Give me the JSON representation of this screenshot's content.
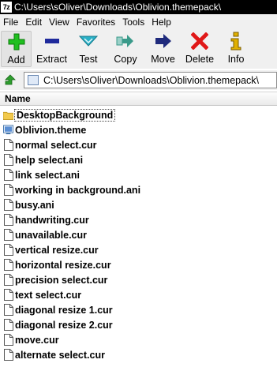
{
  "window": {
    "icon_text": "7z",
    "title": "C:\\Users\\sOliver\\Downloads\\Oblivion.themepack\\"
  },
  "menu": [
    "File",
    "Edit",
    "View",
    "Favorites",
    "Tools",
    "Help"
  ],
  "toolbar": [
    {
      "label": "Add",
      "icon": "plus-icon",
      "color": "#1fbf1f"
    },
    {
      "label": "Extract",
      "icon": "minus-icon",
      "color": "#1f2a9c"
    },
    {
      "label": "Test",
      "icon": "check-down-icon",
      "color": "#29b0c6"
    },
    {
      "label": "Copy",
      "icon": "copy-arrow-icon",
      "color": "#3a9a8a"
    },
    {
      "label": "Move",
      "icon": "move-arrow-icon",
      "color": "#1f2a7c"
    },
    {
      "label": "Delete",
      "icon": "delete-x-icon",
      "color": "#e01818"
    },
    {
      "label": "Info",
      "icon": "info-icon",
      "color": "#e0b000"
    }
  ],
  "address": {
    "path": "C:\\Users\\sOliver\\Downloads\\Oblivion.themepack\\"
  },
  "list": {
    "column_name": "Name",
    "items": [
      {
        "name": "DesktopBackground",
        "type": "folder"
      },
      {
        "name": "Oblivion.theme",
        "type": "theme"
      },
      {
        "name": "normal select.cur",
        "type": "file"
      },
      {
        "name": "help select.ani",
        "type": "file"
      },
      {
        "name": "link select.ani",
        "type": "file"
      },
      {
        "name": "working in background.ani",
        "type": "file"
      },
      {
        "name": "busy.ani",
        "type": "file"
      },
      {
        "name": "handwriting.cur",
        "type": "file"
      },
      {
        "name": "unavailable.cur",
        "type": "file"
      },
      {
        "name": "vertical resize.cur",
        "type": "file"
      },
      {
        "name": "horizontal resize.cur",
        "type": "file"
      },
      {
        "name": "precision select.cur",
        "type": "file"
      },
      {
        "name": "text select.cur",
        "type": "file"
      },
      {
        "name": "diagonal resize 1.cur",
        "type": "file"
      },
      {
        "name": "diagonal resize 2.cur",
        "type": "file"
      },
      {
        "name": "move.cur",
        "type": "file"
      },
      {
        "name": "alternate select.cur",
        "type": "file"
      }
    ]
  }
}
